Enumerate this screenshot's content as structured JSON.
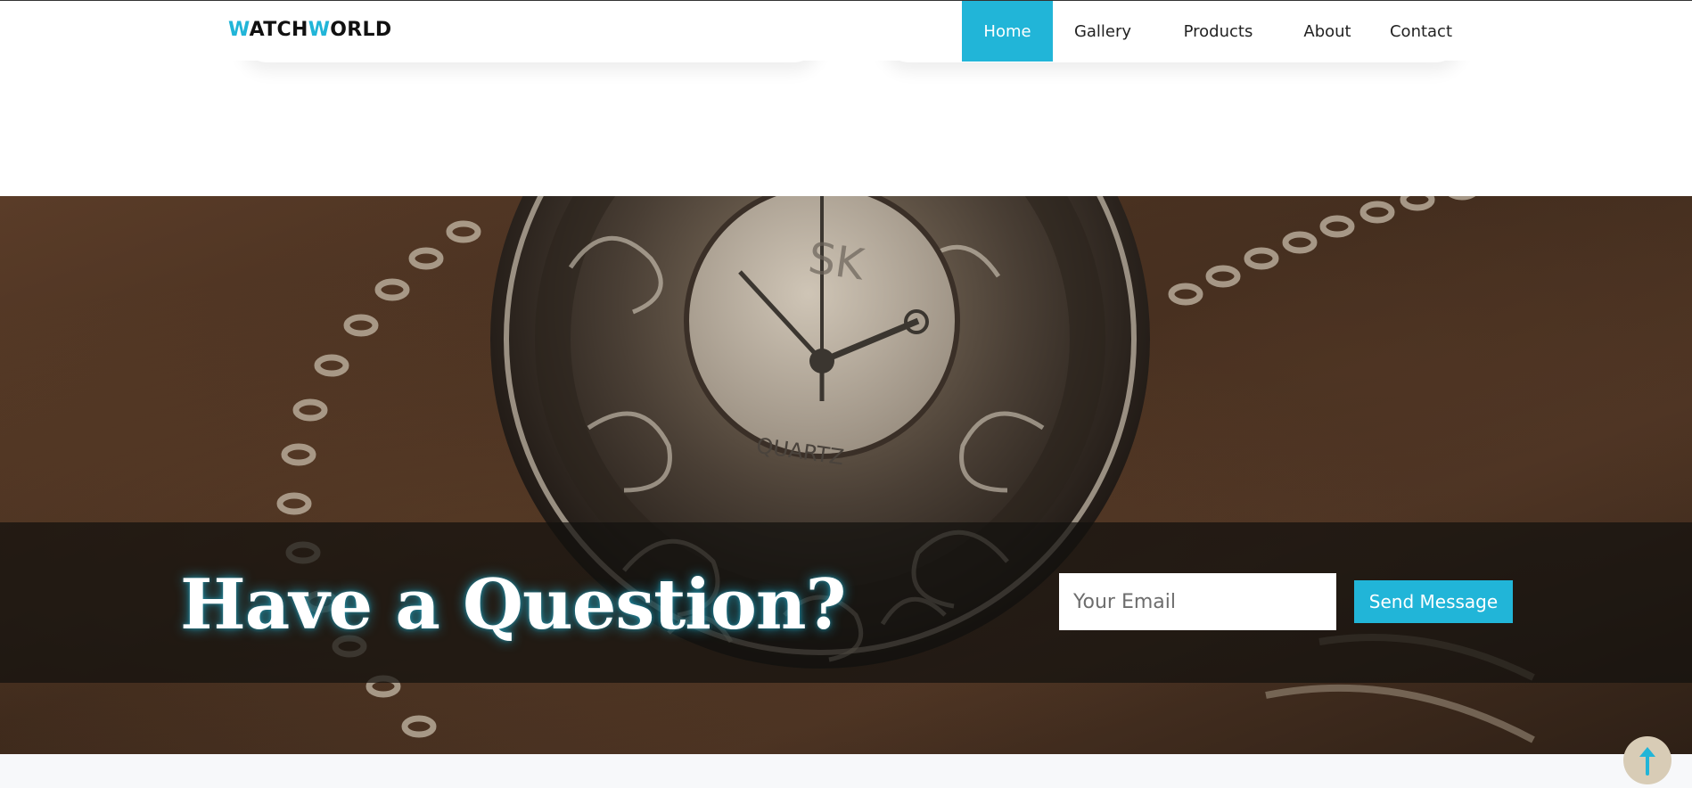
{
  "header": {
    "logo": {
      "first_letter": "W",
      "part1": "ATCH",
      "second_letter": "W",
      "part2": "ORLD"
    },
    "nav": [
      {
        "label": "Home",
        "active": true
      },
      {
        "label": "Gallery",
        "active": false
      },
      {
        "label": "Products",
        "active": false
      },
      {
        "label": "About",
        "active": false
      },
      {
        "label": "Contact",
        "active": false
      }
    ]
  },
  "hero": {
    "title": "Have a Question?",
    "email_placeholder": "Your Email",
    "email_value": "",
    "send_label": "Send Message",
    "watch_brand": "SK",
    "watch_dial_text": "QUARTZ"
  },
  "scroll_top": {
    "icon": "arrow-up-icon"
  },
  "colors": {
    "accent": "#21b5d8",
    "scroll_button": "#d8ccb6",
    "band": "#12100e"
  }
}
